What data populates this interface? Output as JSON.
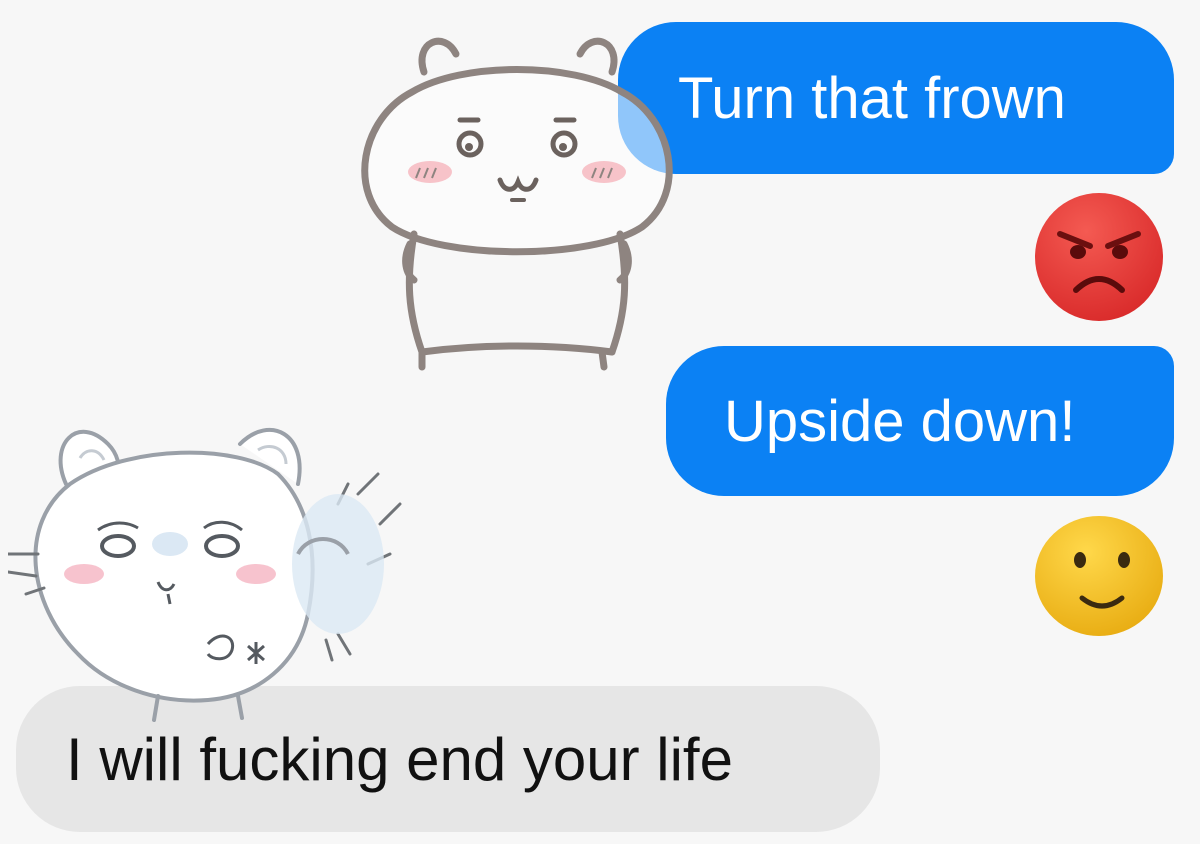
{
  "conversation": {
    "messages": [
      {
        "direction": "outgoing",
        "text": "Turn that frown",
        "reaction_icon": "angry-face-emoji"
      },
      {
        "direction": "outgoing",
        "text": "Upside down!",
        "reaction_icon": "smiling-face-emoji"
      },
      {
        "direction": "incoming",
        "text": "I will fucking end your life"
      }
    ]
  },
  "stickers": [
    {
      "icon": "bear-sticker-icon"
    },
    {
      "icon": "hamster-sticker-icon"
    }
  ],
  "colors": {
    "background": "#f7f7f7",
    "outgoing_bubble": "#0b81f4",
    "incoming_bubble": "#e6e6e6",
    "angry_emoji": "#ea3b3b",
    "smile_emoji": "#f6c428"
  }
}
